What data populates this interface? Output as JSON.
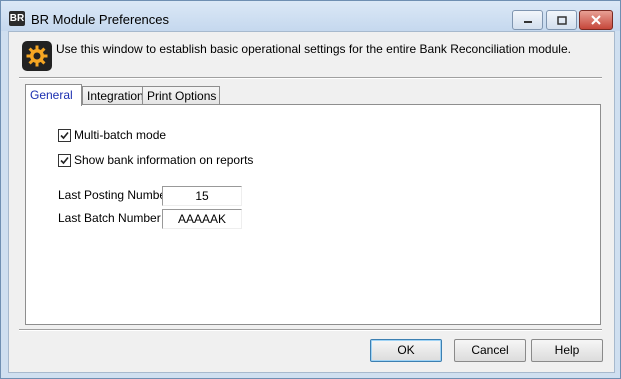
{
  "window": {
    "app_badge": "BR",
    "title": "BR Module Preferences",
    "controls": {
      "minimize": "minimize-icon",
      "maximize": "maximize-icon",
      "close": "close-icon"
    }
  },
  "header": {
    "icon": "gear-icon",
    "description": "Use this window to establish basic operational settings for the entire Bank Reconciliation module."
  },
  "tabs": [
    {
      "label": "General",
      "active": true
    },
    {
      "label": "Integration",
      "active": false
    },
    {
      "label": "Print Options",
      "active": false
    }
  ],
  "general": {
    "multi_batch": {
      "label": "Multi-batch mode",
      "checked": true
    },
    "show_bank_info": {
      "label": "Show bank information on reports",
      "checked": true
    },
    "last_posting": {
      "label": "Last Posting Number",
      "value": "15"
    },
    "last_batch": {
      "label": "Last Batch Number",
      "value": "AAAAAK"
    }
  },
  "buttons": {
    "ok": "OK",
    "cancel": "Cancel",
    "help": "Help"
  },
  "colors": {
    "active_tab_text": "#1b2fb0",
    "title_bar": "#c5d8ee",
    "gear": "#f5a623"
  }
}
